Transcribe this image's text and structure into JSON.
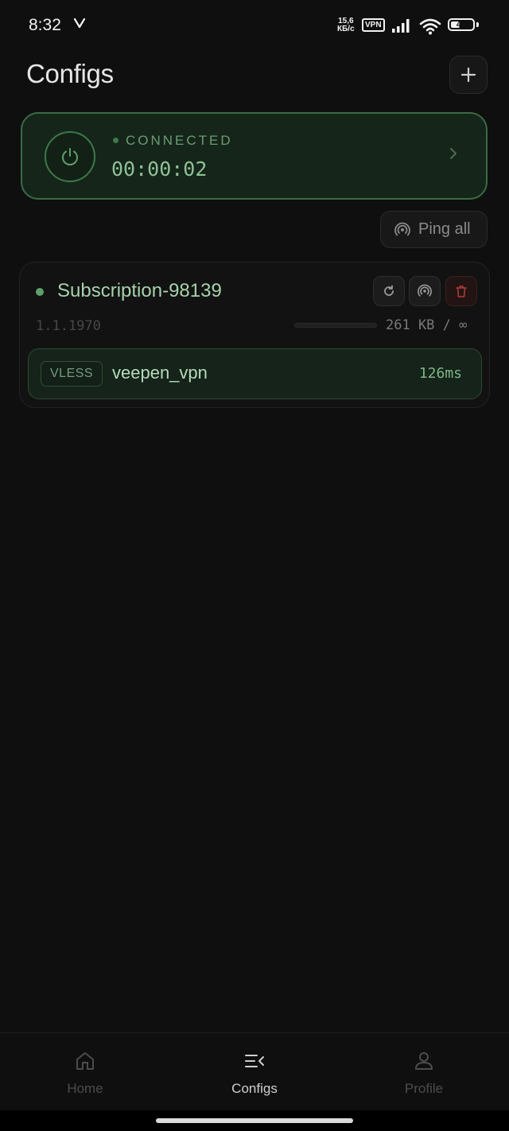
{
  "status_bar": {
    "time": "8:32",
    "speed_value": "15,6",
    "speed_unit": "КБ/с",
    "vpn_label": "VPN",
    "battery": "41",
    "battery_level": 0.41
  },
  "header": {
    "title": "Configs"
  },
  "connection": {
    "status": "CONNECTED",
    "timer": "00:00:02"
  },
  "toolbar": {
    "ping_all_label": "Ping all"
  },
  "subscription": {
    "name": "Subscription-98139",
    "date": "1.1.1970",
    "usage": "261 KB / ∞",
    "usage_fraction": 0.0,
    "servers": [
      {
        "protocol": "VLESS",
        "name": "veepen_vpn",
        "ping": "126ms"
      }
    ]
  },
  "nav": {
    "items": [
      {
        "label": "Home",
        "icon": "home-icon",
        "active": false
      },
      {
        "label": "Configs",
        "icon": "configs-icon",
        "active": true
      },
      {
        "label": "Profile",
        "icon": "profile-icon",
        "active": false
      }
    ]
  },
  "colors": {
    "accent": "#8fc196",
    "connected_border": "#3a6b44",
    "background": "#0f0f0f",
    "danger": "#c0392b"
  }
}
